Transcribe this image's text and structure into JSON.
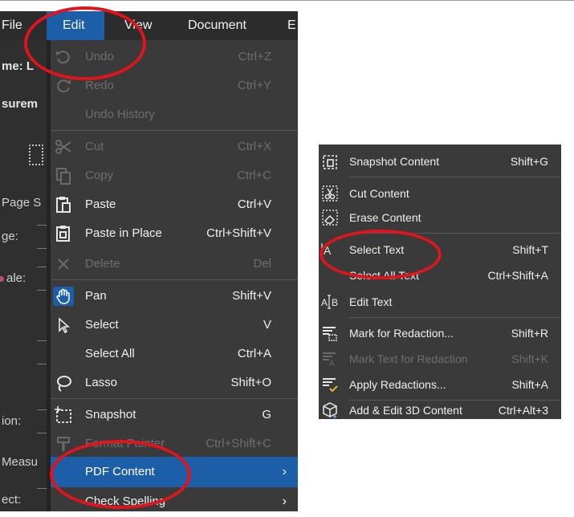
{
  "menubar": {
    "file": "File",
    "edit": "Edit",
    "view": "View",
    "document": "Document",
    "more": "E"
  },
  "background_fragments": {
    "name": "me: L",
    "measurement": "surem",
    "page_scale": "Page S",
    "page": "ge:",
    "scale": "ale:",
    "precision": "ion:",
    "measure": "Measu",
    "select": "ect:"
  },
  "edit_menu": [
    {
      "label": "Undo",
      "shortcut": "Ctrl+Z",
      "icon": "undo-icon",
      "enabled": false
    },
    {
      "label": "Redo",
      "shortcut": "Ctrl+Y",
      "icon": "redo-icon",
      "enabled": false
    },
    {
      "label": "Undo History",
      "shortcut": "",
      "icon": "",
      "enabled": false
    },
    {
      "label": "Cut",
      "shortcut": "Ctrl+X",
      "icon": "scissors-icon",
      "enabled": false
    },
    {
      "label": "Copy",
      "shortcut": "Ctrl+C",
      "icon": "copy-icon",
      "enabled": false
    },
    {
      "label": "Paste",
      "shortcut": "Ctrl+V",
      "icon": "paste-icon",
      "enabled": true
    },
    {
      "label": "Paste in Place",
      "shortcut": "Ctrl+Shift+V",
      "icon": "paste-in-place-icon",
      "enabled": true
    },
    {
      "label": "Delete",
      "shortcut": "Del",
      "icon": "delete-icon",
      "enabled": false
    },
    {
      "label": "Pan",
      "shortcut": "Shift+V",
      "icon": "hand-icon",
      "enabled": true
    },
    {
      "label": "Select",
      "shortcut": "V",
      "icon": "arrow-cursor-icon",
      "enabled": true
    },
    {
      "label": "Select All",
      "shortcut": "Ctrl+A",
      "icon": "",
      "enabled": true
    },
    {
      "label": "Lasso",
      "shortcut": "Shift+O",
      "icon": "lasso-icon",
      "enabled": true
    },
    {
      "label": "Snapshot",
      "shortcut": "G",
      "icon": "snapshot-icon",
      "enabled": true
    },
    {
      "label": "Format Painter",
      "shortcut": "Ctrl+Shift+C",
      "icon": "format-painter-icon",
      "enabled": false
    },
    {
      "label": "PDF Content",
      "shortcut": "",
      "icon": "",
      "enabled": true,
      "submenu": true
    },
    {
      "label": "Check Spelling",
      "shortcut": "",
      "icon": "",
      "enabled": true,
      "submenu": true
    }
  ],
  "pdf_content_submenu": [
    {
      "label": "Snapshot Content",
      "shortcut": "Shift+G",
      "icon": "snapshot-content-icon",
      "enabled": true
    },
    {
      "label": "Cut Content",
      "shortcut": "",
      "icon": "cut-content-icon",
      "enabled": true
    },
    {
      "label": "Erase Content",
      "shortcut": "",
      "icon": "erase-content-icon",
      "enabled": true
    },
    {
      "label": "Select Text",
      "shortcut": "Shift+T",
      "icon": "select-text-icon",
      "enabled": true
    },
    {
      "label": "Select All Text",
      "shortcut": "Ctrl+Shift+A",
      "icon": "",
      "enabled": true
    },
    {
      "label": "Edit Text",
      "shortcut": "",
      "icon": "edit-text-icon",
      "enabled": true
    },
    {
      "label": "Mark for Redaction...",
      "shortcut": "Shift+R",
      "icon": "mark-redaction-icon",
      "enabled": true
    },
    {
      "label": "Mark Text for Redaction",
      "shortcut": "Shift+K",
      "icon": "mark-text-redaction-icon",
      "enabled": false
    },
    {
      "label": "Apply Redactions...",
      "shortcut": "Shift+A",
      "icon": "apply-redactions-icon",
      "enabled": true
    },
    {
      "label": "Add & Edit 3D Content",
      "shortcut": "Ctrl+Alt+3",
      "icon": "cube-3d-icon",
      "enabled": true
    }
  ],
  "colors": {
    "menu_bg": "#3a3a3a",
    "highlight": "#1d5ea8",
    "annotation": "#e0141b",
    "disabled_text": "#6e6e6e"
  }
}
